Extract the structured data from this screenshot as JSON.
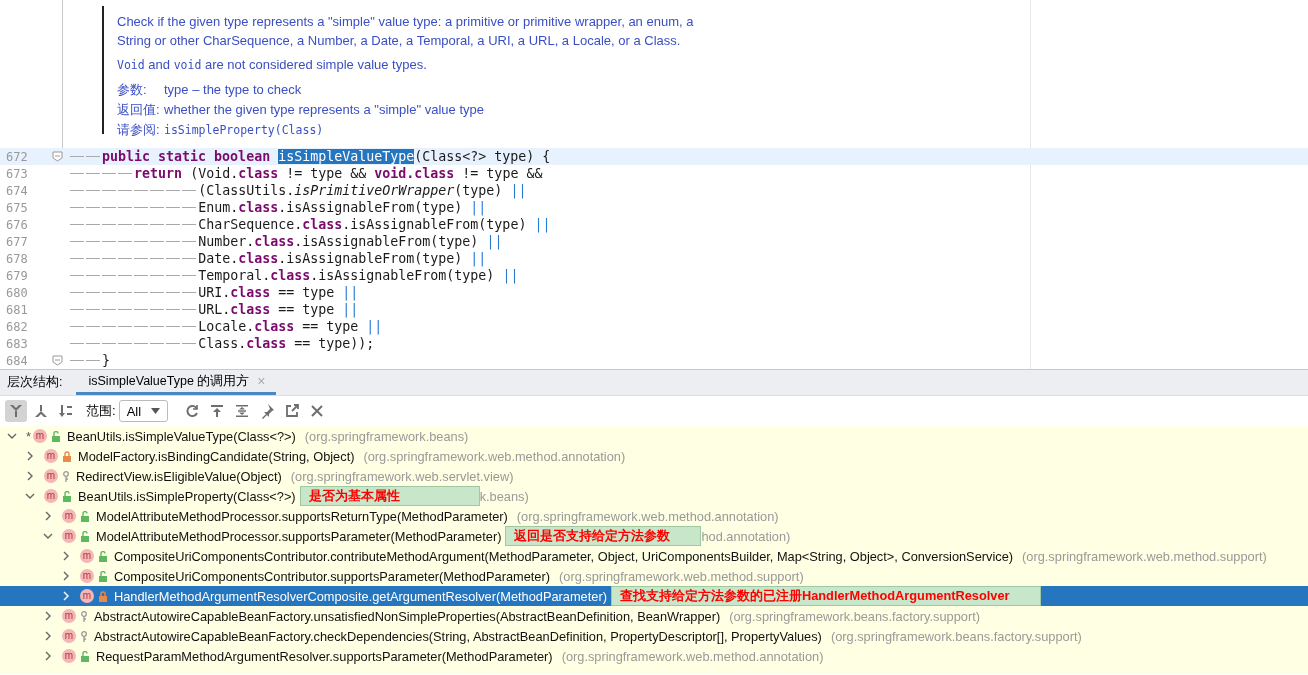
{
  "doc": {
    "paragraphs": [
      [
        {
          "kind": "text",
          "text": "Check if the given type represents a \"simple\" value type: a primitive or primitive wrapper, an enum, a String or other CharSequence, a Number, a Date, a Temporal, a URI, a URL, a Locale, or a Class."
        }
      ],
      [
        {
          "kind": "code",
          "text": "Void"
        },
        {
          "kind": "text",
          "text": " and "
        },
        {
          "kind": "code",
          "text": "void"
        },
        {
          "kind": "text",
          "text": " are not considered simple value types."
        }
      ]
    ],
    "tags": [
      {
        "label": "参数:",
        "parts": [
          {
            "kind": "text",
            "text": "type – the type to check"
          }
        ]
      },
      {
        "label": "返回值:",
        "parts": [
          {
            "kind": "text",
            "text": "whether the given type represents a \"simple\" value type"
          }
        ]
      },
      {
        "label": "请参阅:",
        "parts": [
          {
            "kind": "code",
            "text": "isSimpleProperty(Class)"
          }
        ]
      }
    ]
  },
  "code": [
    {
      "no": "672",
      "kind": "decl",
      "current": true,
      "fold": true,
      "tokens": [
        {
          "kind": "kw",
          "text": "public static boolean"
        },
        {
          "kind": "sel",
          "text": "isSimpleValueType"
        },
        {
          "kind": "tx",
          "text": "(Class<?> type) {"
        }
      ]
    },
    {
      "no": "673",
      "kind": "stmt",
      "current": false,
      "fold": false,
      "tokens": [
        {
          "kind": "kw",
          "text": "return"
        },
        {
          "kind": "tx",
          "text": " (Void."
        },
        {
          "kind": "kw",
          "text": "class"
        },
        {
          "kind": "tx",
          "text": " != type && "
        },
        {
          "kind": "kw",
          "text": "void.class"
        },
        {
          "kind": "tx",
          "text": " != type &&"
        }
      ]
    },
    {
      "no": "674",
      "kind": "cont",
      "current": false,
      "fold": false,
      "tokens": [
        {
          "kind": "tx",
          "text": "(ClassUtils."
        },
        {
          "kind": "it",
          "text": "isPrimitiveOrWrapper"
        },
        {
          "kind": "tx",
          "text": "(type) "
        },
        {
          "kind": "op",
          "text": "||"
        }
      ]
    },
    {
      "no": "675",
      "kind": "cont",
      "current": false,
      "fold": false,
      "tokens": [
        {
          "kind": "tx",
          "text": "Enum."
        },
        {
          "kind": "kw",
          "text": "class"
        },
        {
          "kind": "tx",
          "text": ".isAssignableFrom(type) "
        },
        {
          "kind": "op",
          "text": "||"
        }
      ]
    },
    {
      "no": "676",
      "kind": "cont",
      "current": false,
      "fold": false,
      "tokens": [
        {
          "kind": "tx",
          "text": "CharSequence."
        },
        {
          "kind": "kw",
          "text": "class"
        },
        {
          "kind": "tx",
          "text": ".isAssignableFrom(type) "
        },
        {
          "kind": "op",
          "text": "||"
        }
      ]
    },
    {
      "no": "677",
      "kind": "cont",
      "current": false,
      "fold": false,
      "tokens": [
        {
          "kind": "tx",
          "text": "Number."
        },
        {
          "kind": "kw",
          "text": "class"
        },
        {
          "kind": "tx",
          "text": ".isAssignableFrom(type) "
        },
        {
          "kind": "op",
          "text": "||"
        }
      ]
    },
    {
      "no": "678",
      "kind": "cont",
      "current": false,
      "fold": false,
      "tokens": [
        {
          "kind": "tx",
          "text": "Date."
        },
        {
          "kind": "kw",
          "text": "class"
        },
        {
          "kind": "tx",
          "text": ".isAssignableFrom(type) "
        },
        {
          "kind": "op",
          "text": "||"
        }
      ]
    },
    {
      "no": "679",
      "kind": "cont",
      "current": false,
      "fold": false,
      "tokens": [
        {
          "kind": "tx",
          "text": "Temporal."
        },
        {
          "kind": "kw",
          "text": "class"
        },
        {
          "kind": "tx",
          "text": ".isAssignableFrom(type) "
        },
        {
          "kind": "op",
          "text": "||"
        }
      ]
    },
    {
      "no": "680",
      "kind": "cont",
      "current": false,
      "fold": false,
      "tokens": [
        {
          "kind": "tx",
          "text": "URI."
        },
        {
          "kind": "kw",
          "text": "class"
        },
        {
          "kind": "tx",
          "text": " == type "
        },
        {
          "kind": "op",
          "text": "||"
        }
      ]
    },
    {
      "no": "681",
      "kind": "cont",
      "current": false,
      "fold": false,
      "tokens": [
        {
          "kind": "tx",
          "text": "URL."
        },
        {
          "kind": "kw",
          "text": "class"
        },
        {
          "kind": "tx",
          "text": " == type "
        },
        {
          "kind": "op",
          "text": "||"
        }
      ]
    },
    {
      "no": "682",
      "kind": "cont",
      "current": false,
      "fold": false,
      "tokens": [
        {
          "kind": "tx",
          "text": "Locale."
        },
        {
          "kind": "kw",
          "text": "class"
        },
        {
          "kind": "tx",
          "text": " == type "
        },
        {
          "kind": "op",
          "text": "||"
        }
      ]
    },
    {
      "no": "683",
      "kind": "cont",
      "current": false,
      "fold": false,
      "tokens": [
        {
          "kind": "tx",
          "text": "Class."
        },
        {
          "kind": "kw",
          "text": "class"
        },
        {
          "kind": "tx",
          "text": " == type));"
        }
      ]
    },
    {
      "no": "684",
      "kind": "decl",
      "current": false,
      "fold": true,
      "tokens": [
        {
          "kind": "tx",
          "text": "}"
        }
      ]
    }
  ],
  "panel": {
    "label": "层次结构:",
    "tabs": [
      {
        "label": "isSimpleValueType 的调用方",
        "selected": true,
        "close": "×"
      }
    ],
    "tools": [
      {
        "kind": "callee",
        "selected": true
      },
      {
        "kind": "caller",
        "selected": false
      },
      {
        "kind": "sort",
        "selected": false
      }
    ],
    "scope_label": "范围:",
    "scope": "All",
    "actions": [
      {
        "kind": "refresh"
      },
      {
        "kind": "export-up"
      },
      {
        "kind": "collapse"
      },
      {
        "kind": "pin"
      },
      {
        "kind": "open"
      },
      {
        "kind": "close"
      }
    ],
    "tree": [
      {
        "name": "BeanUtils.isSimpleValueType(Class<?>)",
        "package": "(org.springframework.beans)",
        "marker": "*",
        "badge": "m",
        "kind": "public",
        "expanded": true,
        "selected": false,
        "children": [
          {
            "name": "ModelFactory.isBindingCandidate(String, Object)",
            "package": "(org.springframework.web.method.annotation)",
            "badge": "m",
            "kind": "private",
            "expanded": false,
            "selected": false
          },
          {
            "name": "RedirectView.isEligibleValue(Object)",
            "package": "(org.springframework.web.servlet.view)",
            "badge": "m",
            "kind": "package",
            "expanded": false,
            "selected": false
          },
          {
            "name": "BeanUtils.isSimpleProperty(Class<?>)",
            "note": "是否为基本属性",
            "package": "k.beans)",
            "badge": "m",
            "kind": "public",
            "expanded": true,
            "selected": false,
            "children": [
              {
                "name": "ModelAttributeMethodProcessor.supportsReturnType(MethodParameter)",
                "package": "(org.springframework.web.method.annotation)",
                "badge": "m",
                "kind": "public",
                "expanded": false,
                "selected": false
              },
              {
                "name": "ModelAttributeMethodProcessor.supportsParameter(MethodParameter)",
                "note": "返回是否支持给定方法参数",
                "package": "hod.annotation)",
                "badge": "m",
                "kind": "public",
                "expanded": true,
                "selected": false,
                "children": [
                  {
                    "name": "CompositeUriComponentsContributor.contributeMethodArgument(MethodParameter, Object, UriComponentsBuilder, Map<String, Object>, ConversionService)",
                    "package": "(org.springframework.web.method.support)",
                    "badge": "m",
                    "kind": "public",
                    "expanded": false,
                    "selected": false
                  },
                  {
                    "name": "CompositeUriComponentsContributor.supportsParameter(MethodParameter)",
                    "package": "(org.springframework.web.method.support)",
                    "badge": "m",
                    "kind": "public",
                    "expanded": false,
                    "selected": false
                  },
                  {
                    "name": "HandlerMethodArgumentResolverComposite.getArgumentResolver(MethodParameter)",
                    "note": "查找支持给定方法参数的已注册HandlerMethodArgumentResolver",
                    "badge": "m",
                    "kind": "private",
                    "expanded": false,
                    "selected": true
                  }
                ]
              },
              {
                "name": "AbstractAutowireCapableBeanFactory.unsatisfiedNonSimpleProperties(AbstractBeanDefinition, BeanWrapper)",
                "package": "(org.springframework.beans.factory.support)",
                "badge": "m",
                "kind": "package",
                "expanded": false,
                "selected": false
              },
              {
                "name": "AbstractAutowireCapableBeanFactory.checkDependencies(String, AbstractBeanDefinition, PropertyDescriptor[], PropertyValues)",
                "package": "(org.springframework.beans.factory.support)",
                "badge": "m",
                "kind": "package",
                "expanded": false,
                "selected": false
              },
              {
                "name": "RequestParamMethodArgumentResolver.supportsParameter(MethodParameter)",
                "package": "(org.springframework.web.method.annotation)",
                "badge": "m",
                "kind": "public",
                "expanded": false,
                "selected": false
              }
            ]
          }
        ]
      }
    ]
  }
}
